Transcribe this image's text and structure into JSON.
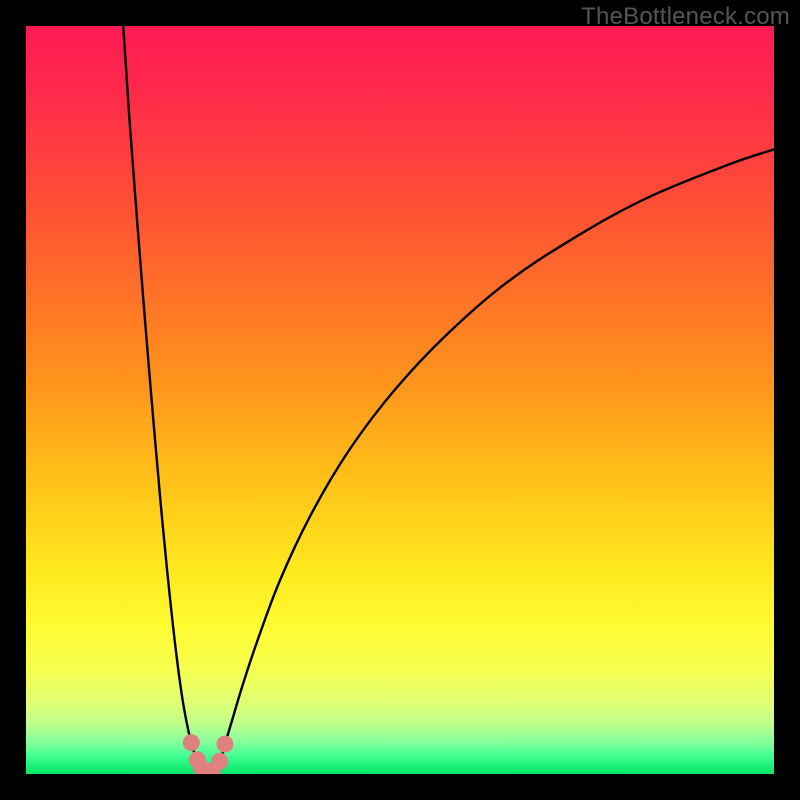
{
  "watermark": "TheBottleneck.com",
  "chart_data": {
    "type": "line",
    "title": "",
    "xlabel": "",
    "ylabel": "",
    "xlim": [
      0,
      100
    ],
    "ylim": [
      0,
      100
    ],
    "grid": false,
    "series": [
      {
        "name": "curve-left",
        "x": [
          13.0,
          13.8,
          14.7,
          15.6,
          16.5,
          17.4,
          18.3,
          19.2,
          20.1,
          21.0,
          22.0,
          22.6,
          23.1,
          23.5,
          23.8,
          24.1,
          24.4
        ],
        "y": [
          100.0,
          88.0,
          76.0,
          64.5,
          53.5,
          43.0,
          33.0,
          24.0,
          16.0,
          9.5,
          4.5,
          2.6,
          1.3,
          0.5,
          0.15,
          0.03,
          0.0
        ]
      },
      {
        "name": "curve-right",
        "x": [
          24.4,
          24.8,
          25.3,
          25.7,
          26.2,
          26.6,
          27.5,
          29.0,
          31.0,
          34.0,
          38.0,
          43.0,
          49.0,
          56.0,
          64.0,
          73.0,
          83.0,
          94.0,
          100.0
        ],
        "y": [
          0.0,
          0.1,
          0.5,
          1.3,
          2.5,
          4.0,
          7.0,
          12.0,
          18.0,
          26.0,
          34.5,
          43.0,
          51.0,
          58.5,
          65.5,
          71.5,
          77.0,
          81.5,
          83.5
        ]
      },
      {
        "name": "dots",
        "type": "scatter",
        "x": [
          22.1,
          22.9,
          23.4,
          23.9,
          24.9,
          25.9,
          26.6
        ],
        "y": [
          4.2,
          1.9,
          0.9,
          0.4,
          0.4,
          1.7,
          4.0
        ]
      }
    ],
    "background_gradient": {
      "stops": [
        {
          "offset": 0.0,
          "color": "#ff1a54"
        },
        {
          "offset": 0.1,
          "color": "#ff2c4a"
        },
        {
          "offset": 0.22,
          "color": "#ff4a37"
        },
        {
          "offset": 0.35,
          "color": "#ff6f28"
        },
        {
          "offset": 0.48,
          "color": "#ff951c"
        },
        {
          "offset": 0.6,
          "color": "#ffbf18"
        },
        {
          "offset": 0.72,
          "color": "#ffe61e"
        },
        {
          "offset": 0.8,
          "color": "#fffb30"
        },
        {
          "offset": 0.86,
          "color": "#f6ff4e"
        },
        {
          "offset": 0.9,
          "color": "#e3ff70"
        },
        {
          "offset": 0.93,
          "color": "#c3ff8a"
        },
        {
          "offset": 0.955,
          "color": "#8cff9a"
        },
        {
          "offset": 0.975,
          "color": "#46ff94"
        },
        {
          "offset": 1.0,
          "color": "#00e765"
        }
      ]
    },
    "colors": {
      "curve": "#000000",
      "dots": "#e08080"
    }
  }
}
